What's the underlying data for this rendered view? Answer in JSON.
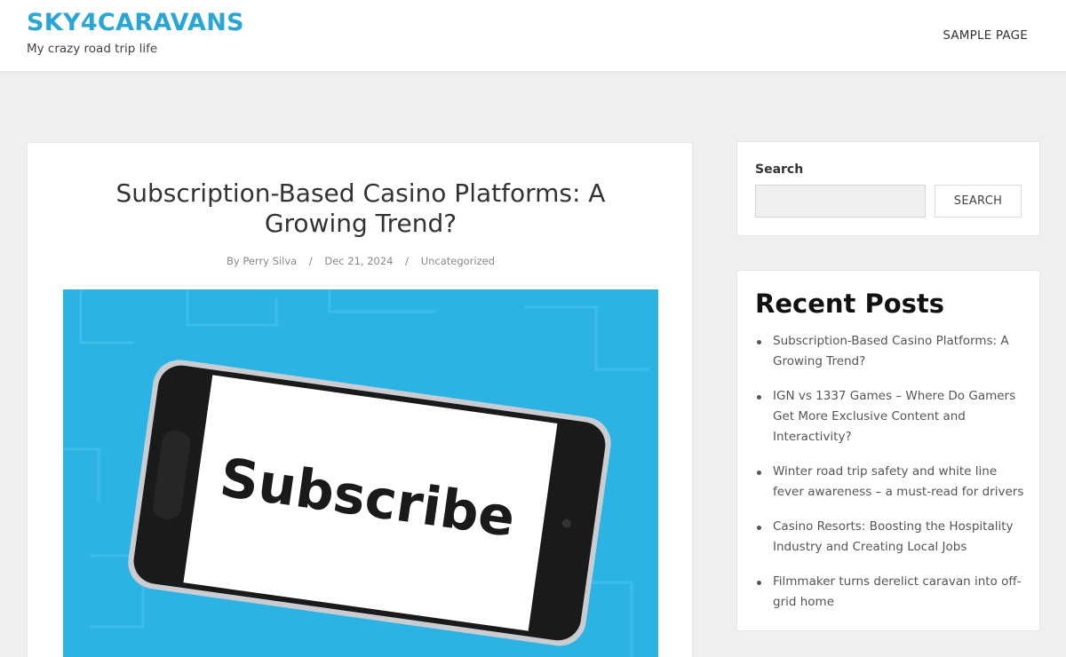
{
  "site": {
    "title": "SKY4CARAVANS",
    "tagline": "My crazy road trip life",
    "title_color": "#2aa6d6"
  },
  "nav": {
    "items": [
      {
        "label": "SAMPLE PAGE"
      }
    ]
  },
  "post": {
    "title": "Subscription-Based Casino Platforms: A Growing Trend?",
    "meta": {
      "by_label": "By",
      "author": "Perry Silva",
      "date": "Dec 21, 2024",
      "category": "Uncategorized",
      "separator": "/"
    },
    "image": {
      "screen_text": "Subscribe",
      "background_color": "#2bb3e3"
    }
  },
  "sidebar": {
    "search": {
      "label": "Search",
      "input_value": "",
      "button_label": "SEARCH"
    },
    "recent_posts": {
      "heading": "Recent Posts",
      "items": [
        {
          "label": "Subscription-Based Casino Platforms: A Growing Trend?"
        },
        {
          "label": "IGN vs 1337 Games – Where Do Gamers Get More Exclusive Content and Interactivity?"
        },
        {
          "label": "Winter road trip safety and white line fever awareness – a must-read for drivers"
        },
        {
          "label": "Casino Resorts: Boosting the Hospitality Industry and Creating Local Jobs"
        },
        {
          "label": "Filmmaker turns derelict caravan into off-grid home"
        }
      ]
    }
  }
}
